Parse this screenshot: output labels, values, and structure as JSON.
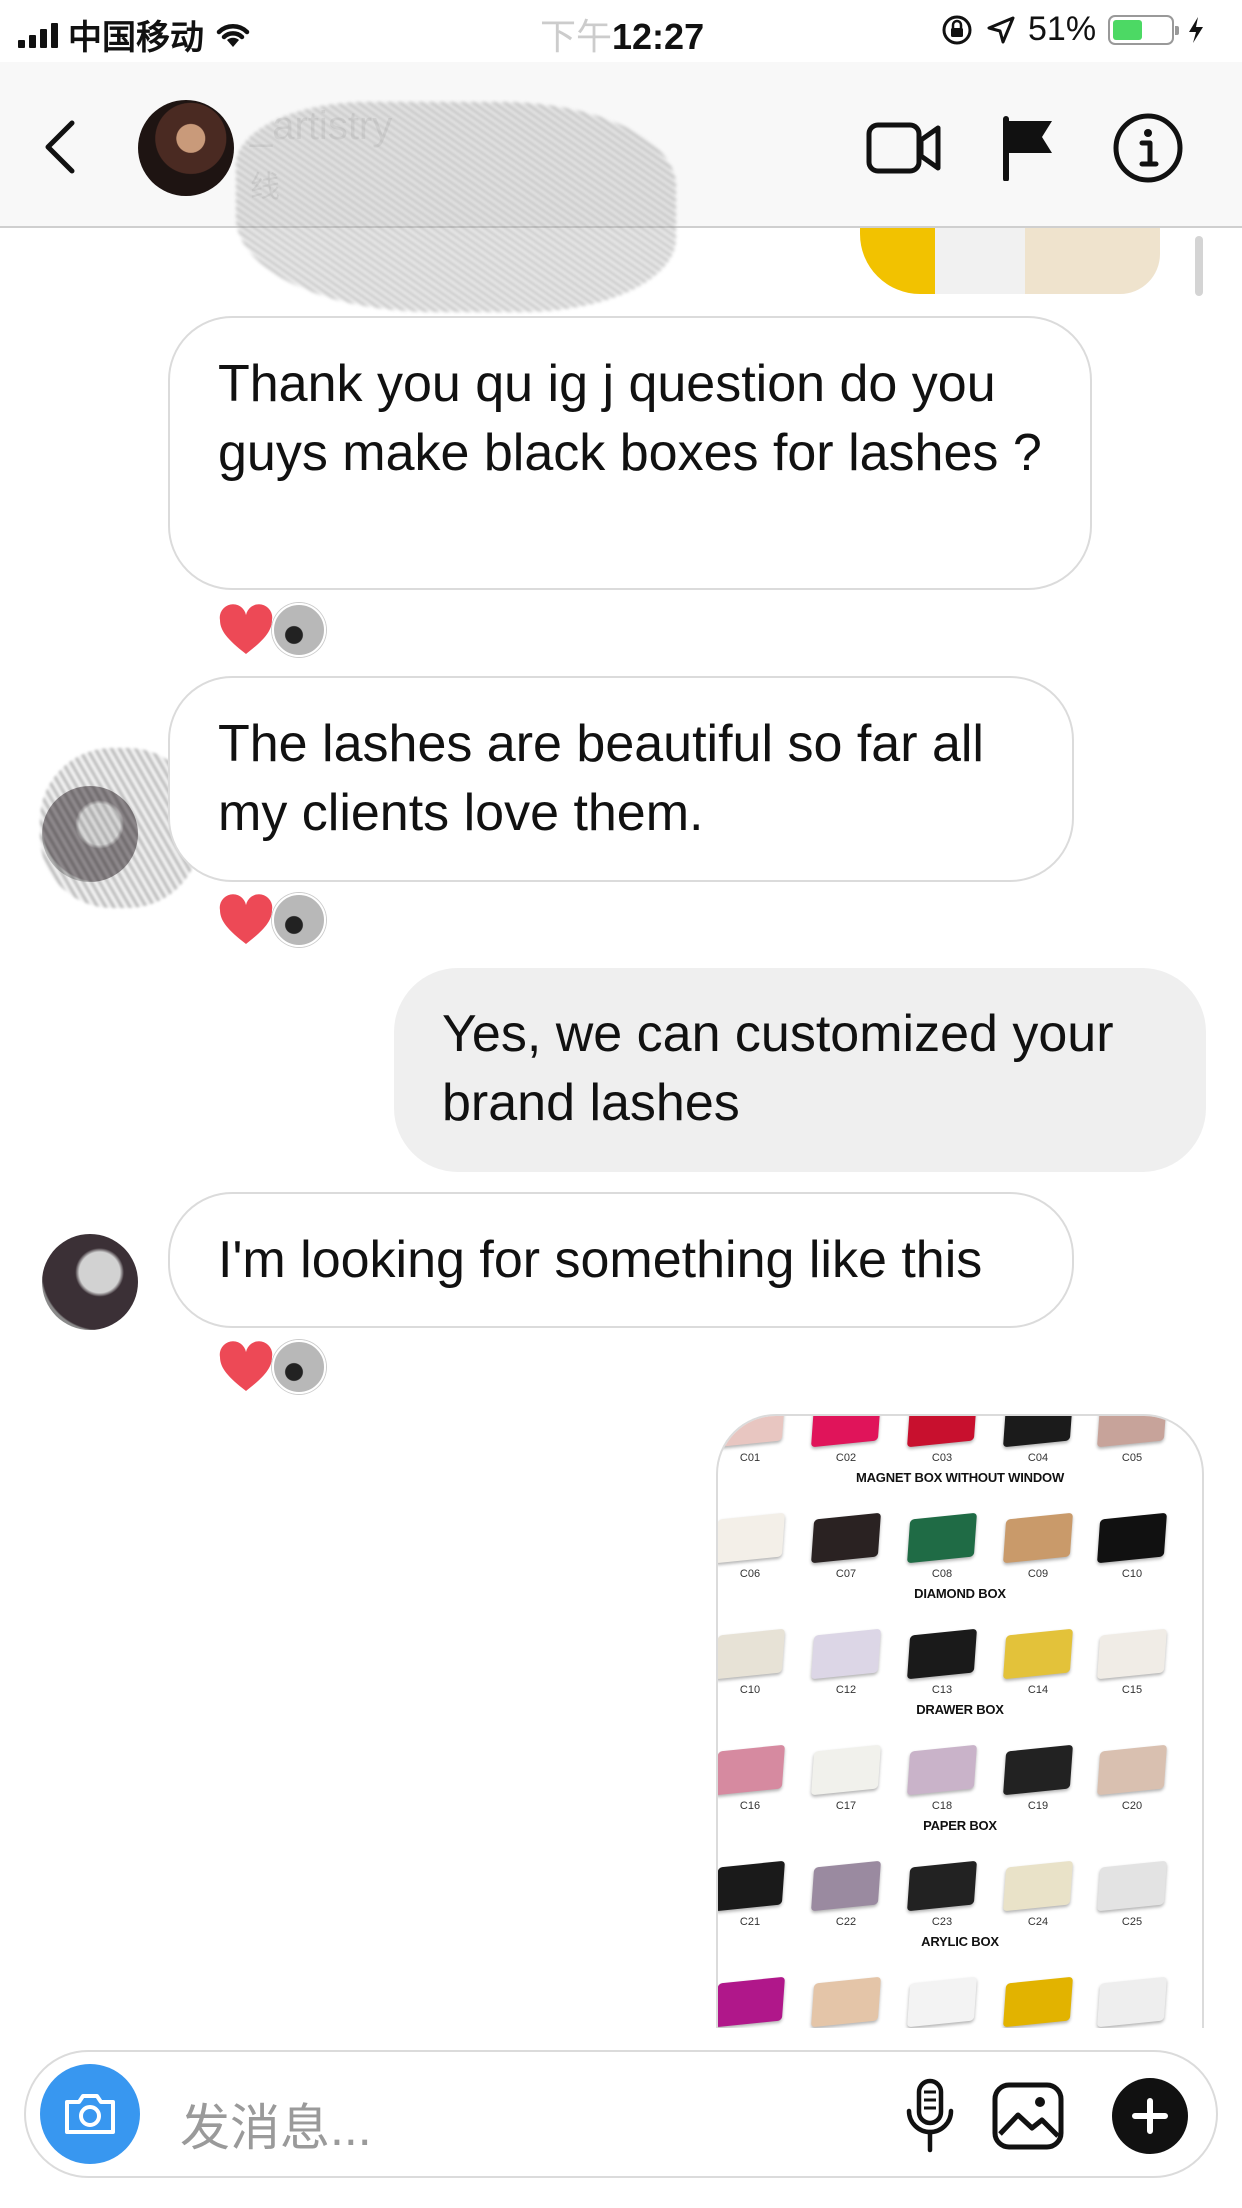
{
  "status_bar": {
    "carrier": "中国移动",
    "time_prefix": "下午",
    "time": "12:27",
    "battery": "51%",
    "battery_level": 0.51,
    "icons": [
      "signal-icon",
      "wifi-icon",
      "orientation-lock-icon",
      "location-arrow-icon",
      "battery-icon",
      "charging-icon"
    ]
  },
  "header": {
    "back_icon": "chevron-left-icon",
    "contact_name": "_artistry",
    "contact_sub": "线",
    "actions": [
      "video-call-icon",
      "flag-icon",
      "info-icon"
    ]
  },
  "messages": [
    {
      "id": "m1",
      "direction": "in",
      "text": "Thank you qu ig j question do you guys make black boxes for lashes ?",
      "reacted": true
    },
    {
      "id": "m2",
      "direction": "in",
      "text": "The lashes are beautiful so far all my clients love them.",
      "reacted": true
    },
    {
      "id": "m3",
      "direction": "out",
      "text": "Yes, we can customized your brand lashes",
      "reacted": false
    },
    {
      "id": "m4",
      "direction": "in",
      "text": "I'm looking for something like this",
      "reacted": true
    },
    {
      "id": "m5",
      "direction": "out",
      "type": "image"
    }
  ],
  "catalog": {
    "rows": [
      {
        "codes": [
          "C01",
          "C02",
          "C03",
          "C04",
          "C05"
        ],
        "section_below": "MAGNET BOX WITHOUT WINDOW"
      },
      {
        "codes": [
          "C06",
          "C07",
          "C08",
          "C09",
          "C10"
        ],
        "section_below": "DIAMOND BOX"
      },
      {
        "codes": [
          "C10",
          "C12",
          "C13",
          "C14",
          "C15"
        ],
        "section_below": "DRAWER BOX"
      },
      {
        "codes": [
          "C16",
          "C17",
          "C18",
          "C19",
          "C20"
        ],
        "section_below": "PAPER BOX"
      },
      {
        "codes": [
          "C21",
          "C22",
          "C23",
          "C24",
          "C25"
        ],
        "section_below": "ARYLIC BOX"
      }
    ],
    "box_colors": [
      [
        "#e8c6c1",
        "#e0145a",
        "#c8102e",
        "#1b1b1b",
        "#c7a39a"
      ],
      [
        "#f3efe8",
        "#2a2222",
        "#1f6b45",
        "#c99a6a",
        "#111111"
      ],
      [
        "#e7e2d6",
        "#dcd6e6",
        "#1a1a1a",
        "#e3c23a",
        "#f0ece6"
      ],
      [
        "#d68aa0",
        "#f1f1ec",
        "#c9b3c9",
        "#222222",
        "#d9c0b0"
      ],
      [
        "#1a1a1a",
        "#9a8aa0",
        "#222222",
        "#e9e2c8",
        "#e3e3e3"
      ],
      [
        "#b0178a",
        "#e4c5a8",
        "#f3f3f3",
        "#e2b300",
        "#eeeeee"
      ]
    ]
  },
  "composer": {
    "placeholder": "发消息...",
    "icons": [
      "camera-icon",
      "microphone-icon",
      "gallery-icon",
      "plus-icon"
    ]
  },
  "colors": {
    "accent": "#3897f0",
    "heart": "#ed4956",
    "outgoing_bubble": "#efefef",
    "incoming_border": "#dbdbdb"
  }
}
